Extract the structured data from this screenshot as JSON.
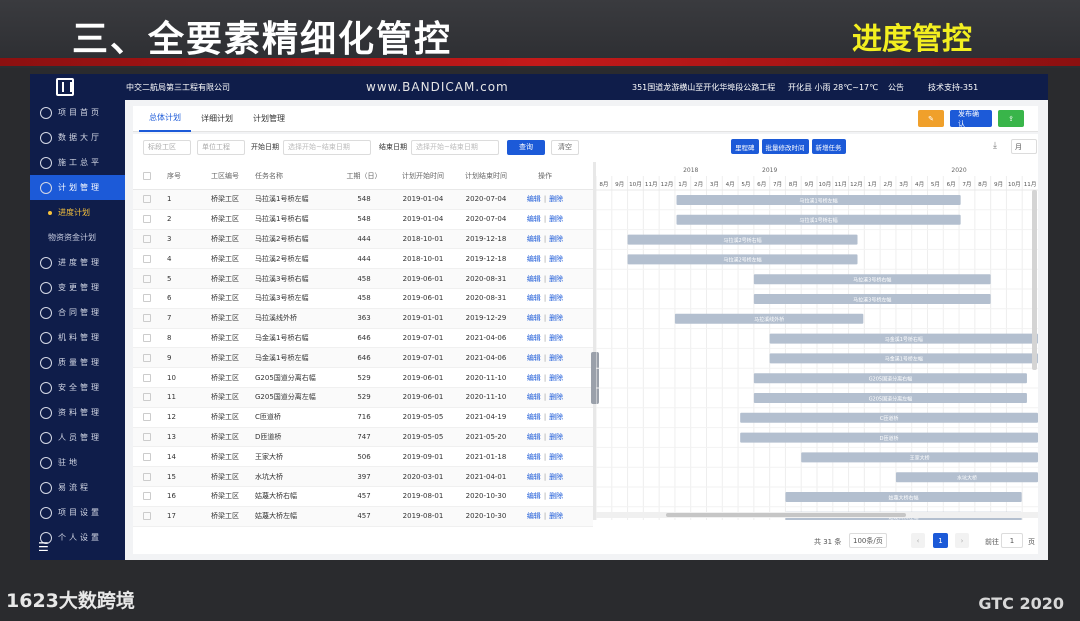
{
  "slide": {
    "title": "三、全要素精细化管控",
    "subtitle": "进度管控",
    "watermark": "1623大数跨境",
    "footer": "GTC 2020"
  },
  "header": {
    "company": "中交二航局第三工程有限公司",
    "recorder": "www.BANDICAM.com",
    "project": "351国道龙游横山至开化华埠段公路工程",
    "weather": "开化县 小雨 28℃~17℃",
    "notice": "公告",
    "account": "技术支持-351"
  },
  "sidebar": {
    "items": [
      {
        "label": "项目首页",
        "icon": "home-icon",
        "active": false
      },
      {
        "label": "数据大厅",
        "icon": "dashboard-icon",
        "active": false
      },
      {
        "label": "施工总平",
        "icon": "map-icon",
        "active": false
      },
      {
        "label": "计划管理",
        "icon": "plan-icon",
        "active": true
      }
    ],
    "sub_items": [
      {
        "label": "进度计划",
        "current": true
      },
      {
        "label": "物资资金计划",
        "current": false
      }
    ],
    "items_after": [
      {
        "label": "进度管理",
        "icon": "progress-icon"
      },
      {
        "label": "变更管理",
        "icon": "change-icon"
      },
      {
        "label": "合同管理",
        "icon": "contract-icon"
      },
      {
        "label": "机料管理",
        "icon": "machine-icon"
      },
      {
        "label": "质量管理",
        "icon": "quality-icon"
      },
      {
        "label": "安全管理",
        "icon": "safety-icon"
      },
      {
        "label": "资料管理",
        "icon": "document-icon"
      },
      {
        "label": "人员管理",
        "icon": "people-icon"
      },
      {
        "label": "驻地",
        "icon": "camp-icon"
      },
      {
        "label": "易流程",
        "icon": "flow-icon"
      },
      {
        "label": "项目设置",
        "icon": "settings-icon"
      },
      {
        "label": "个人设置",
        "icon": "user-icon"
      }
    ]
  },
  "tabs": [
    "总体计划",
    "详细计划",
    "计划管理"
  ],
  "top_actions": {
    "publish": "发布确认"
  },
  "filters": {
    "work_area": "标段工区",
    "project": "单位工程",
    "start_label": "开始日期",
    "start_placeholder": "选择开始~结束日期",
    "end_label": "结束日期",
    "end_placeholder": "选择开始~结束日期",
    "query": "查询",
    "clear": "清空"
  },
  "gantt_buttons": [
    "里程碑",
    "批量修改时间",
    "新增任务"
  ],
  "gantt_unit": "月",
  "columns": [
    "序号",
    "工区编号",
    "任务名称",
    "工期（日）",
    "计划开始时间",
    "计划结束时间",
    "操作"
  ],
  "op_edit": "编辑",
  "op_delete": "删除",
  "rows": [
    {
      "seq": "1",
      "code": "桥梁工区",
      "name": "马拉溪1号桥左幅",
      "dur": "548",
      "start": "2019-01-04",
      "end": "2020-07-04"
    },
    {
      "seq": "2",
      "code": "桥梁工区",
      "name": "马拉溪1号桥右幅",
      "dur": "548",
      "start": "2019-01-04",
      "end": "2020-07-04"
    },
    {
      "seq": "3",
      "code": "桥梁工区",
      "name": "马拉溪2号桥右幅",
      "dur": "444",
      "start": "2018-10-01",
      "end": "2019-12-18"
    },
    {
      "seq": "4",
      "code": "桥梁工区",
      "name": "马拉溪2号桥左幅",
      "dur": "444",
      "start": "2018-10-01",
      "end": "2019-12-18"
    },
    {
      "seq": "5",
      "code": "桥梁工区",
      "name": "马拉溪3号桥右幅",
      "dur": "458",
      "start": "2019-06-01",
      "end": "2020-08-31"
    },
    {
      "seq": "6",
      "code": "桥梁工区",
      "name": "马拉溪3号桥左幅",
      "dur": "458",
      "start": "2019-06-01",
      "end": "2020-08-31"
    },
    {
      "seq": "7",
      "code": "桥梁工区",
      "name": "马拉溪线外桥",
      "dur": "363",
      "start": "2019-01-01",
      "end": "2019-12-29"
    },
    {
      "seq": "8",
      "code": "桥梁工区",
      "name": "马金溪1号桥右幅",
      "dur": "646",
      "start": "2019-07-01",
      "end": "2021-04-06"
    },
    {
      "seq": "9",
      "code": "桥梁工区",
      "name": "马金溪1号桥左幅",
      "dur": "646",
      "start": "2019-07-01",
      "end": "2021-04-06"
    },
    {
      "seq": "10",
      "code": "桥梁工区",
      "name": "G205国道分离右幅",
      "dur": "529",
      "start": "2019-06-01",
      "end": "2020-11-10"
    },
    {
      "seq": "11",
      "code": "桥梁工区",
      "name": "G205国道分离左幅",
      "dur": "529",
      "start": "2019-06-01",
      "end": "2020-11-10"
    },
    {
      "seq": "12",
      "code": "桥梁工区",
      "name": "C匝道桥",
      "dur": "716",
      "start": "2019-05-05",
      "end": "2021-04-19"
    },
    {
      "seq": "13",
      "code": "桥梁工区",
      "name": "D匝道桥",
      "dur": "747",
      "start": "2019-05-05",
      "end": "2021-05-20"
    },
    {
      "seq": "14",
      "code": "桥梁工区",
      "name": "王家大桥",
      "dur": "506",
      "start": "2019-09-01",
      "end": "2021-01-18"
    },
    {
      "seq": "15",
      "code": "桥梁工区",
      "name": "水坑大桥",
      "dur": "397",
      "start": "2020-03-01",
      "end": "2021-04-01"
    },
    {
      "seq": "16",
      "code": "桥梁工区",
      "name": "姑蔑大桥右幅",
      "dur": "457",
      "start": "2019-08-01",
      "end": "2020-10-30"
    },
    {
      "seq": "17",
      "code": "桥梁工区",
      "name": "姑蔑大桥左幅",
      "dur": "457",
      "start": "2019-08-01",
      "end": "2020-10-30"
    }
  ],
  "gantt": {
    "years": [
      "2018",
      "2019",
      "2020"
    ],
    "months": [
      "8月",
      "9月",
      "10月",
      "11月",
      "12月",
      "1月",
      "2月",
      "3月",
      "4月",
      "5月",
      "6月",
      "7月",
      "8月",
      "9月",
      "10月",
      "11月",
      "12月",
      "1月",
      "2月",
      "3月",
      "4月",
      "5月",
      "6月",
      "7月",
      "8月",
      "9月",
      "10月",
      "11月"
    ],
    "bar_color": "#b3bfcf"
  },
  "pager": {
    "total": "共 31 条",
    "size": "100条/页",
    "current": "1",
    "goto": "前往",
    "input": "1",
    "page": "页"
  }
}
